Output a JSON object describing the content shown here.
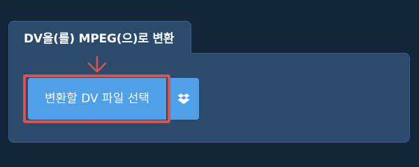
{
  "tab": {
    "title": "DV을(를) MPEG(으)로 변환"
  },
  "actions": {
    "choose_file_label": "변환할 DV 파일 선택",
    "dropbox_icon": "dropbox-icon"
  },
  "colors": {
    "background": "#132539",
    "panel": "#2c4a6b",
    "button": "#4fa0e8",
    "highlight": "#d9534f"
  }
}
